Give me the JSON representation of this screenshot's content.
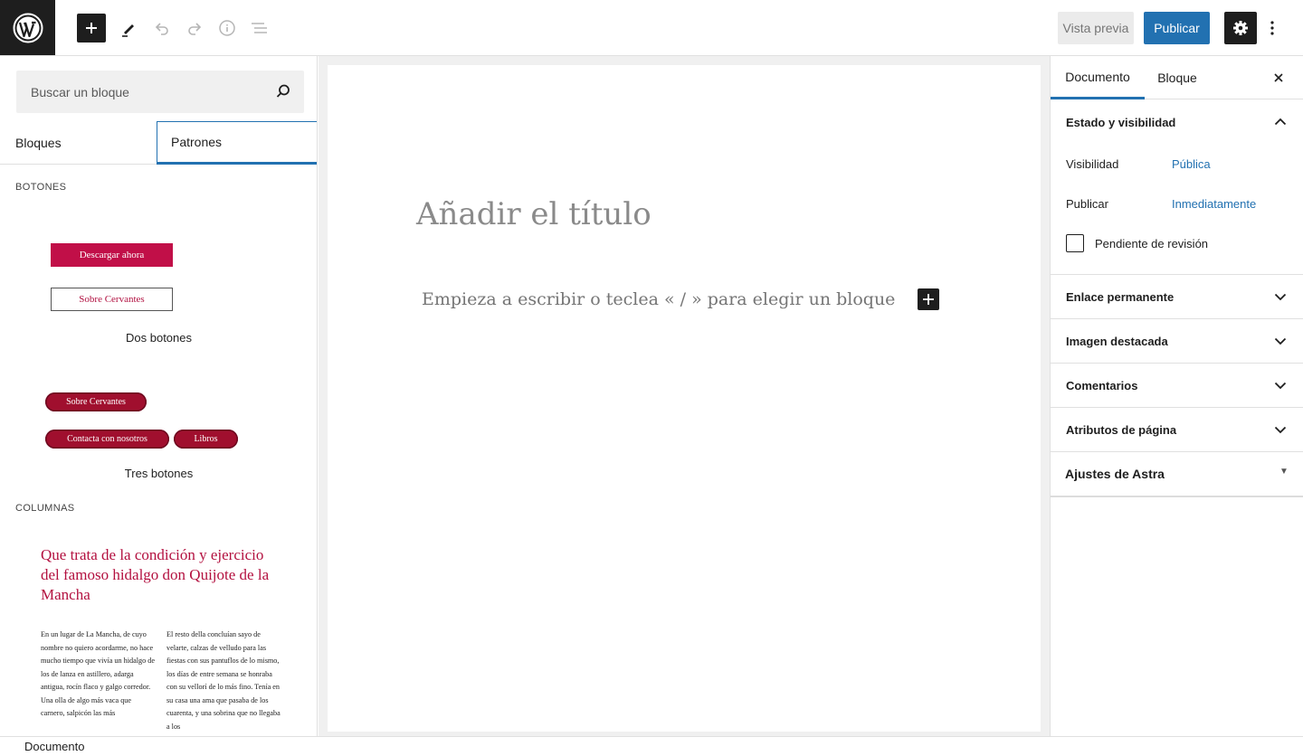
{
  "toolbar": {
    "preview_label": "Vista previa",
    "publish_label": "Publicar"
  },
  "inserter": {
    "search_placeholder": "Buscar un bloque",
    "tabs": [
      "Bloques",
      "Patrones"
    ],
    "active_tab": "Patrones",
    "sections": [
      {
        "label": "BOTONES",
        "patterns": [
          {
            "name": "Dos botones",
            "buttons": [
              "Descargar ahora",
              "Sobre Cervantes"
            ]
          },
          {
            "name": "Tres botones",
            "buttons": [
              "Sobre Cervantes",
              "Contacta con nosotros",
              "Libros"
            ]
          }
        ]
      },
      {
        "label": "COLUMNAS",
        "patterns": [
          {
            "heading": "Que trata de la condición y ejercicio del famoso hidalgo don Quijote de la Mancha",
            "column_1": "En un lugar de La Mancha, de cuyo nombre no quiero acordarme, no hace mucho tiempo que vivía un hidalgo de los de lanza en astillero, adarga antigua, rocín flaco y galgo corredor. Una olla de algo más vaca que carnero, salpicón las más",
            "column_2": "El resto della concluían sayo de velarte, calzas de velludo para las fiestas con sus pantuflos de lo mismo, los días de entre semana se honraba con su vellorí de lo más fino. Tenía en su casa una ama que pasaba de los cuarenta, y una sobrina que no llegaba a los"
          }
        ]
      }
    ]
  },
  "editor": {
    "title_placeholder": "Añadir el título",
    "body_placeholder": "Empieza a escribir o teclea « / » para elegir un bloque"
  },
  "sidebar": {
    "tabs": [
      "Documento",
      "Bloque"
    ],
    "active_tab": "Documento",
    "status_panel": {
      "title": "Estado y visibilidad",
      "visibility_label": "Visibilidad",
      "visibility_value": "Pública",
      "publish_label": "Publicar",
      "publish_value": "Inmediatamente",
      "pending_review_label": "Pendiente de revisión",
      "pending_review_checked": false
    },
    "panels": [
      "Enlace permanente",
      "Imagen destacada",
      "Comentarios",
      "Atributos de página"
    ],
    "astra_panel": "Ajustes de Astra"
  },
  "footer": {
    "breadcrumb": "Documento"
  },
  "colors": {
    "accent": "#2271b1",
    "pattern_red": "#c10f48",
    "dark": "#1e1e1e"
  },
  "icons": [
    "wordpress-logo-icon",
    "plus-icon",
    "pencil-icon",
    "undo-icon",
    "redo-icon",
    "info-icon",
    "list-view-icon",
    "gear-icon",
    "more-vertical-icon",
    "search-icon",
    "close-icon",
    "chevron-up-icon",
    "chevron-down-icon",
    "caret-down-icon"
  ]
}
